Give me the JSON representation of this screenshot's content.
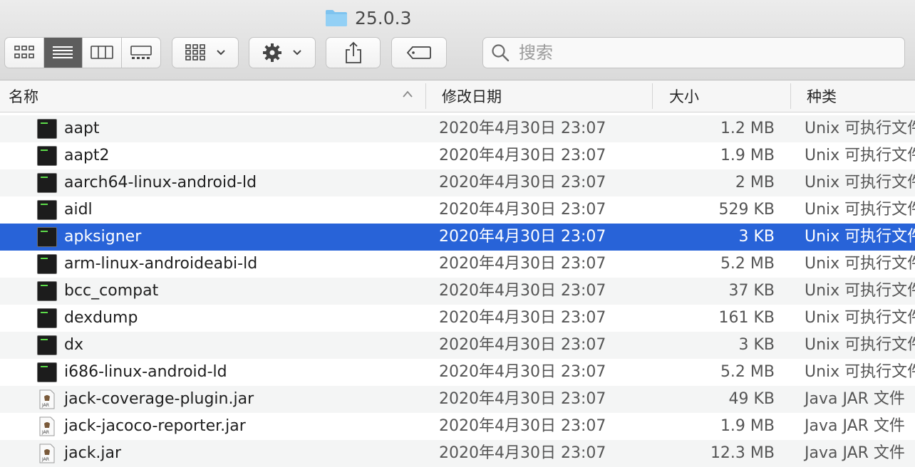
{
  "window": {
    "title": "25.0.3"
  },
  "toolbar": {
    "views": [
      {
        "name": "icon-view",
        "icon": "grid-icon",
        "active": false
      },
      {
        "name": "list-view",
        "icon": "list-icon",
        "active": true
      },
      {
        "name": "column-view",
        "icon": "columns-icon",
        "active": false
      },
      {
        "name": "gallery-view",
        "icon": "gallery-icon",
        "active": false
      }
    ],
    "group_icon": "group-grid-icon",
    "action_icon": "gear-icon",
    "share_icon": "share-icon",
    "tag_icon": "tag-icon"
  },
  "search": {
    "placeholder": "搜索",
    "value": ""
  },
  "columns": {
    "name": "名称",
    "date": "修改日期",
    "size": "大小",
    "kind": "种类"
  },
  "rows": [
    {
      "name": "aapt",
      "date": "2020年4月30日 23:07",
      "size": "1.2 MB",
      "kind": "Unix 可执行文件",
      "icon": "terminal-icon"
    },
    {
      "name": "aapt2",
      "date": "2020年4月30日 23:07",
      "size": "1.9 MB",
      "kind": "Unix 可执行文件",
      "icon": "terminal-icon"
    },
    {
      "name": "aarch64-linux-android-ld",
      "date": "2020年4月30日 23:07",
      "size": "2 MB",
      "kind": "Unix 可执行文件",
      "icon": "terminal-icon"
    },
    {
      "name": "aidl",
      "date": "2020年4月30日 23:07",
      "size": "529 KB",
      "kind": "Unix 可执行文件",
      "icon": "terminal-icon"
    },
    {
      "name": "apksigner",
      "date": "2020年4月30日 23:07",
      "size": "3 KB",
      "kind": "Unix 可执行文件",
      "icon": "terminal-icon",
      "selected": true
    },
    {
      "name": "arm-linux-androideabi-ld",
      "date": "2020年4月30日 23:07",
      "size": "5.2 MB",
      "kind": "Unix 可执行文件",
      "icon": "terminal-icon"
    },
    {
      "name": "bcc_compat",
      "date": "2020年4月30日 23:07",
      "size": "37 KB",
      "kind": "Unix 可执行文件",
      "icon": "terminal-icon"
    },
    {
      "name": "dexdump",
      "date": "2020年4月30日 23:07",
      "size": "161 KB",
      "kind": "Unix 可执行文件",
      "icon": "terminal-icon"
    },
    {
      "name": "dx",
      "date": "2020年4月30日 23:07",
      "size": "3 KB",
      "kind": "Unix 可执行文件",
      "icon": "terminal-icon"
    },
    {
      "name": "i686-linux-android-ld",
      "date": "2020年4月30日 23:07",
      "size": "5.2 MB",
      "kind": "Unix 可执行文件",
      "icon": "terminal-icon"
    },
    {
      "name": "jack-coverage-plugin.jar",
      "date": "2020年4月30日 23:07",
      "size": "49 KB",
      "kind": "Java JAR 文件",
      "icon": "jar-icon"
    },
    {
      "name": "jack-jacoco-reporter.jar",
      "date": "2020年4月30日 23:07",
      "size": "1.9 MB",
      "kind": "Java JAR 文件",
      "icon": "jar-icon"
    },
    {
      "name": "jack.jar",
      "date": "2020年4月30日 23:07",
      "size": "12.3 MB",
      "kind": "Java JAR 文件",
      "icon": "jar-icon"
    }
  ]
}
